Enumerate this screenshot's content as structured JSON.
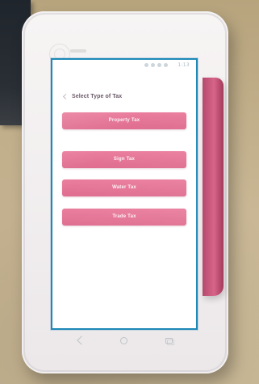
{
  "screen": {
    "title": "Select Type of Tax",
    "status_time": "1:13",
    "tax_options": [
      "Property Tax",
      "Sign Tax",
      "Water Tax",
      "Trade Tax"
    ]
  },
  "icons": {
    "back": "back-icon",
    "home": "home-icon",
    "recent": "recent-apps-icon",
    "logo": "brand-logo-icon"
  },
  "colors": {
    "accent": "#df6d90",
    "screen_border": "#1d89b7",
    "device_stripe": "#c7567c"
  }
}
